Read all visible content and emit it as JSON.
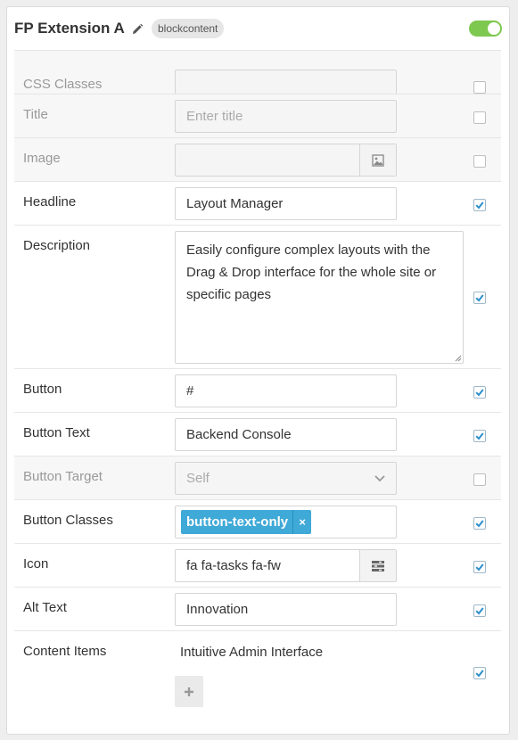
{
  "panel": {
    "title": "FP Extension A",
    "badge": "blockcontent",
    "enabled": true,
    "accent_color": "#7ec850",
    "chip_color": "#3fa9d7",
    "check_color": "#2b8fcb"
  },
  "fields": {
    "css_classes": {
      "label": "CSS Classes",
      "value": "",
      "checked": false
    },
    "title": {
      "label": "Title",
      "placeholder": "Enter title",
      "checked": false
    },
    "image": {
      "label": "Image",
      "value": "",
      "icon": "image-icon",
      "checked": false
    },
    "headline": {
      "label": "Headline",
      "value": "Layout Manager",
      "checked": true
    },
    "description": {
      "label": "Description",
      "value": "Easily configure complex layouts with the Drag & Drop interface for the whole site or specific pages",
      "checked": true
    },
    "button": {
      "label": "Button",
      "value": "#",
      "checked": true
    },
    "button_text": {
      "label": "Button Text",
      "value": "Backend Console",
      "checked": true
    },
    "button_target": {
      "label": "Button Target",
      "value": "Self",
      "checked": false
    },
    "button_classes": {
      "label": "Button Classes",
      "tag": "button-text-only",
      "tag_remove": "×",
      "checked": true
    },
    "icon": {
      "label": "Icon",
      "value": "fa fa-tasks fa-fw",
      "icon": "list-picker-icon",
      "checked": true
    },
    "alt_text": {
      "label": "Alt Text",
      "value": "Innovation",
      "checked": true
    },
    "content_items": {
      "label": "Content Items",
      "item": "Intuitive Admin Interface",
      "add_icon": "plus-icon",
      "checked": true
    }
  }
}
